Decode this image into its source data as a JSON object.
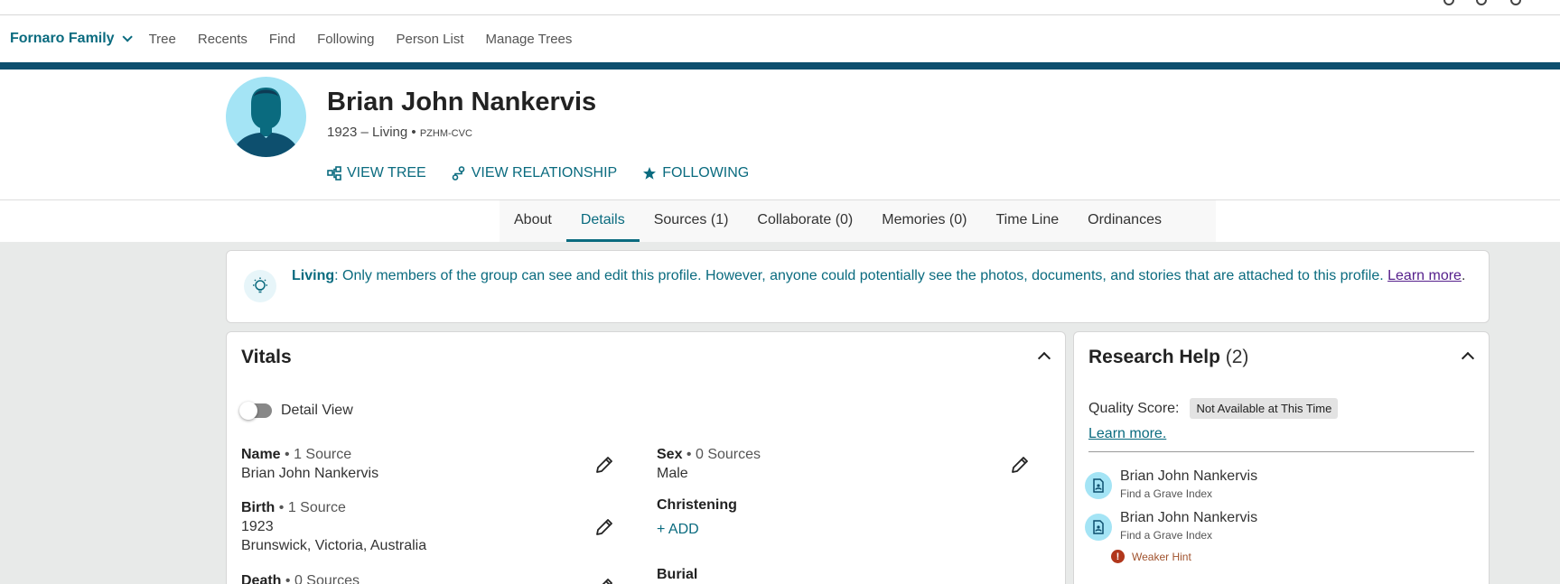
{
  "tree_nav": {
    "tree_name": "Fornaro Family",
    "items": [
      "Tree",
      "Recents",
      "Find",
      "Following",
      "Person List",
      "Manage Trees"
    ]
  },
  "person": {
    "name": "Brian John Nankervis",
    "lifespan": "1923 – Living",
    "id": "PZHM-CVC",
    "actions": {
      "view_tree": "VIEW TREE",
      "view_relationship": "VIEW RELATIONSHIP",
      "following": "FOLLOWING"
    }
  },
  "tabs": [
    "About",
    "Details",
    "Sources (1)",
    "Collaborate (0)",
    "Memories (0)",
    "Time Line",
    "Ordinances"
  ],
  "active_tab": "Details",
  "notice": {
    "label": "Living",
    "text": ": Only members of the group can see and edit this profile. However, anyone could potentially see the photos, documents, and stories that are attached to this profile.",
    "link": "Learn more",
    "end": "."
  },
  "vitals": {
    "title": "Vitals",
    "detail_view": "Detail View",
    "name": {
      "label": "Name",
      "sources": "1 Source",
      "value": "Brian John Nankervis"
    },
    "birth": {
      "label": "Birth",
      "sources": "1 Source",
      "date": "1923",
      "place": "Brunswick, Victoria, Australia"
    },
    "death": {
      "label": "Death",
      "sources": "0 Sources"
    },
    "sex": {
      "label": "Sex",
      "sources": "0 Sources",
      "value": "Male"
    },
    "christening": {
      "label": "Christening",
      "add": "+ ADD"
    },
    "burial": {
      "label": "Burial"
    },
    "separator": " • "
  },
  "research": {
    "title": "Research Help",
    "count": "(2)",
    "quality_label": "Quality Score:",
    "quality_value": "Not Available at This Time",
    "learn_more": "Learn more.",
    "hints": [
      {
        "name": "Brian John Nankervis",
        "source": "Find a Grave Index"
      },
      {
        "name": "Brian John Nankervis",
        "source": "Find a Grave Index"
      }
    ],
    "weaker_hint": "Weaker Hint"
  },
  "colors": {
    "teal": "#0a6b7f",
    "navy_bar": "#0d4f6e",
    "avatar_bg": "#a4e4f5",
    "page_bg": "#e8eae9",
    "weaker_hint": "#b1371c"
  },
  "icons": [
    "tree-icon",
    "relationship-icon",
    "star-icon",
    "lightbulb-icon",
    "pencil-icon",
    "record-hint-icon",
    "alert-icon",
    "chevron-down-icon",
    "chevron-up-icon"
  ]
}
